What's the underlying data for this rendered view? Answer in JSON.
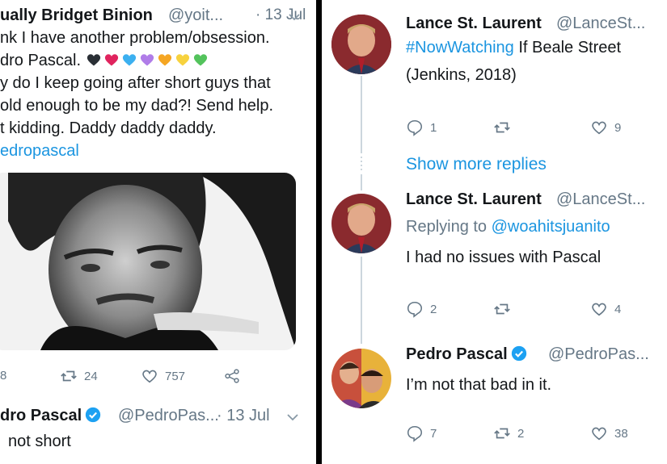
{
  "left": {
    "tweet": {
      "name": "ually Bridget Binion",
      "handle": "@yoit...",
      "time": "· 13 Jul",
      "lines": [
        "nk I have another problem/obsession.",
        "dro Pascal.",
        "y do I keep going after short guys that",
        "old enough to be my dad?! Send help.",
        "t kidding. Daddy daddy daddy."
      ],
      "hashtag": "edropascal",
      "heart_colors": [
        "#2a2f35",
        "#e0245e",
        "#3cb0f0",
        "#b07de8",
        "#f5a623",
        "#f7d23e",
        "#53c35c"
      ],
      "actions": {
        "reply": "8",
        "retweet": "24",
        "like": "757"
      }
    },
    "reply": {
      "name": "dro Pascal",
      "handle": "@PedroPas...",
      "time": "· 13 Jul",
      "text": "not short"
    }
  },
  "right": {
    "tweet1": {
      "name": "Lance St. Laurent",
      "handle": "@LanceSt...",
      "hashtag": "#NowWatching",
      "text_rest": "If Beale Street",
      "text_line2": "(Jenkins, 2018)",
      "actions": {
        "reply": "1",
        "retweet": "",
        "like": "9"
      }
    },
    "show_more": "Show more replies",
    "tweet2": {
      "name": "Lance St. Laurent",
      "handle": "@LanceSt...",
      "replying_prefix": "Replying to",
      "replying_to": "@woahitsjuanito",
      "text": "I had no issues with Pascal",
      "actions": {
        "reply": "2",
        "retweet": "",
        "like": "4"
      }
    },
    "tweet3": {
      "name": "Pedro Pascal",
      "handle": "@PedroPas...",
      "text": "I’m not that bad in it.",
      "actions": {
        "reply": "7",
        "retweet": "2",
        "like": "38"
      }
    }
  },
  "colors": {
    "link": "#1b95e0",
    "verified": "#1da1f2",
    "muted": "#657786"
  }
}
